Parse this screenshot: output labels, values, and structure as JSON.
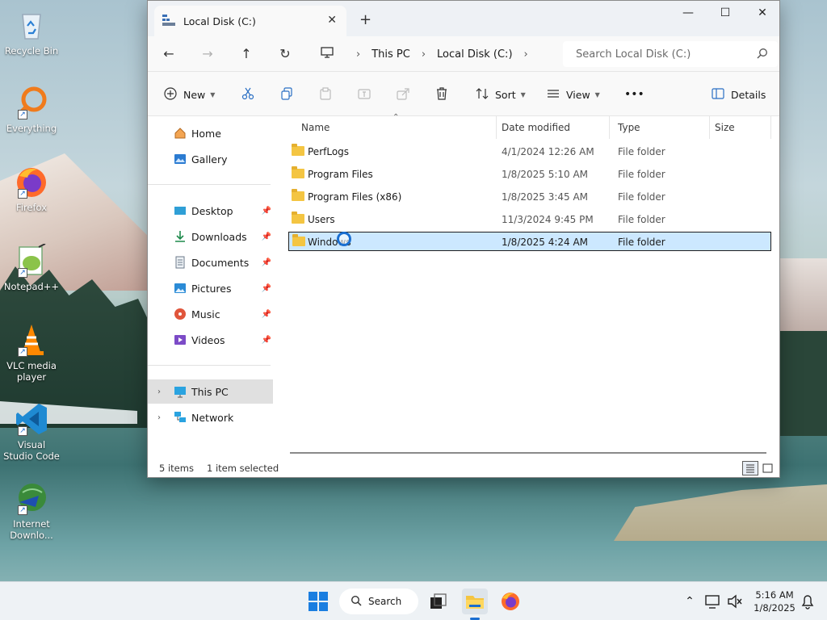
{
  "desktop": {
    "icons": [
      {
        "label": "Recycle Bin"
      },
      {
        "label": "Everything"
      },
      {
        "label": "Firefox"
      },
      {
        "label": "Notepad++"
      },
      {
        "label": "VLC media player"
      },
      {
        "label": "Visual Studio Code"
      },
      {
        "label": "Internet Downlo..."
      }
    ]
  },
  "window": {
    "tab_title": "Local Disk (C:)",
    "tab_close": "✕",
    "new_tab": "+",
    "minimize": "—",
    "maximize": "☐",
    "close": "✕"
  },
  "address": {
    "crumbs": [
      "This PC",
      "Local Disk (C:)"
    ],
    "search_placeholder": "Search Local Disk (C:)"
  },
  "toolbar": {
    "new_label": "New",
    "sort_label": "Sort",
    "view_label": "View",
    "more_label": "•••",
    "details_label": "Details"
  },
  "nav": {
    "home": "Home",
    "gallery": "Gallery",
    "quick_access": [
      {
        "label": "Desktop"
      },
      {
        "label": "Downloads"
      },
      {
        "label": "Documents"
      },
      {
        "label": "Pictures"
      },
      {
        "label": "Music"
      },
      {
        "label": "Videos"
      }
    ],
    "this_pc": "This PC",
    "network": "Network"
  },
  "files": {
    "columns": {
      "name": "Name",
      "date": "Date modified",
      "type": "Type",
      "size": "Size"
    },
    "rows": [
      {
        "name": "PerfLogs",
        "date": "4/1/2024 12:26 AM",
        "type": "File folder"
      },
      {
        "name": "Program Files",
        "date": "1/8/2025 5:10 AM",
        "type": "File folder"
      },
      {
        "name": "Program Files (x86)",
        "date": "1/8/2025 3:45 AM",
        "type": "File folder"
      },
      {
        "name": "Users",
        "date": "11/3/2024 9:45 PM",
        "type": "File folder"
      },
      {
        "name": "Windows",
        "date": "1/8/2025 4:24 AM",
        "type": "File folder"
      }
    ],
    "selected_index": 4
  },
  "status": {
    "count": "5 items",
    "selection": "1 item selected"
  },
  "taskbar": {
    "search_label": "Search",
    "time": "5:16 AM",
    "date": "1/8/2025"
  },
  "colors": {
    "accent": "#1b6fd1",
    "selection": "#cce8ff",
    "folder": "#f4c542"
  }
}
